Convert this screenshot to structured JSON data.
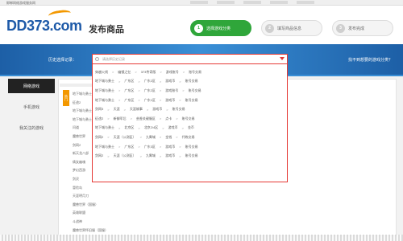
{
  "topbar": {
    "slogan": "邯郸网络游戏服务网",
    "links": [
      "",
      "",
      "",
      "",
      ""
    ]
  },
  "logo": {
    "text": "DD373.com"
  },
  "page": {
    "title": "发布商品"
  },
  "steps": [
    {
      "num": "1",
      "label": "选择游戏分类",
      "active": true
    },
    {
      "num": "2",
      "label": "填写商品信息",
      "active": false
    },
    {
      "num": "3",
      "label": "发布完成",
      "active": false
    }
  ],
  "history": {
    "label": "历史选择记录：",
    "placeholder": "请选择历史记录",
    "records": [
      [
        "穿越火线",
        "幽镜之忆",
        "373传奇版",
        "游戏账号",
        "账号交易"
      ],
      [
        "地下城与勇士",
        "广东区",
        "广东2区",
        "游戏币",
        "账号交易"
      ],
      [
        "地下城与勇士",
        "广东区",
        "广东2区",
        "游戏账号",
        "账号交易"
      ],
      [
        "地下城与勇士",
        "广东区",
        "广东1区",
        "游戏币",
        "账号交易"
      ],
      [
        "剑网3",
        "天涯",
        "天涯故事",
        "游戏币",
        "账号交易"
      ],
      [
        "征途2",
        "新御军后",
        "芸香关键服区",
        "点卡",
        "账号交易"
      ],
      [
        "地下城与勇士",
        "北京区",
        "北京2/4区",
        "游戏币",
        "金币"
      ],
      [
        "剑网2",
        "天涯（公测区）",
        "九霄城",
        "金钱",
        "代练交易"
      ],
      [
        "地下城与勇士",
        "广东区",
        "广东3区",
        "游戏币",
        "账号交易"
      ],
      [
        "剑网2",
        "天涯（公测区）",
        "九霄城",
        "游戏币",
        "账号交易"
      ]
    ]
  },
  "help": {
    "label": "找不到想要的游戏分类？"
  },
  "leftnav": [
    {
      "label": "网络游戏",
      "active": true
    },
    {
      "label": "手机游戏",
      "active": false
    },
    {
      "label": "我关注的游戏",
      "active": false
    }
  ],
  "alpha_tab": "热门",
  "games": [
    "地下城与勇士",
    "征途2",
    "地下城与勇士",
    "地下城与勇士",
    "问道",
    "魔兽世界",
    "剑网2",
    "新天龙八部",
    "倩女幽魂",
    "梦幻西游",
    "剑灵",
    "冒险岛",
    "天涯明月刀",
    "魔兽世界（国服）",
    "英雄联盟",
    "斗战神",
    "魔兽世界怀旧服（国服）"
  ]
}
